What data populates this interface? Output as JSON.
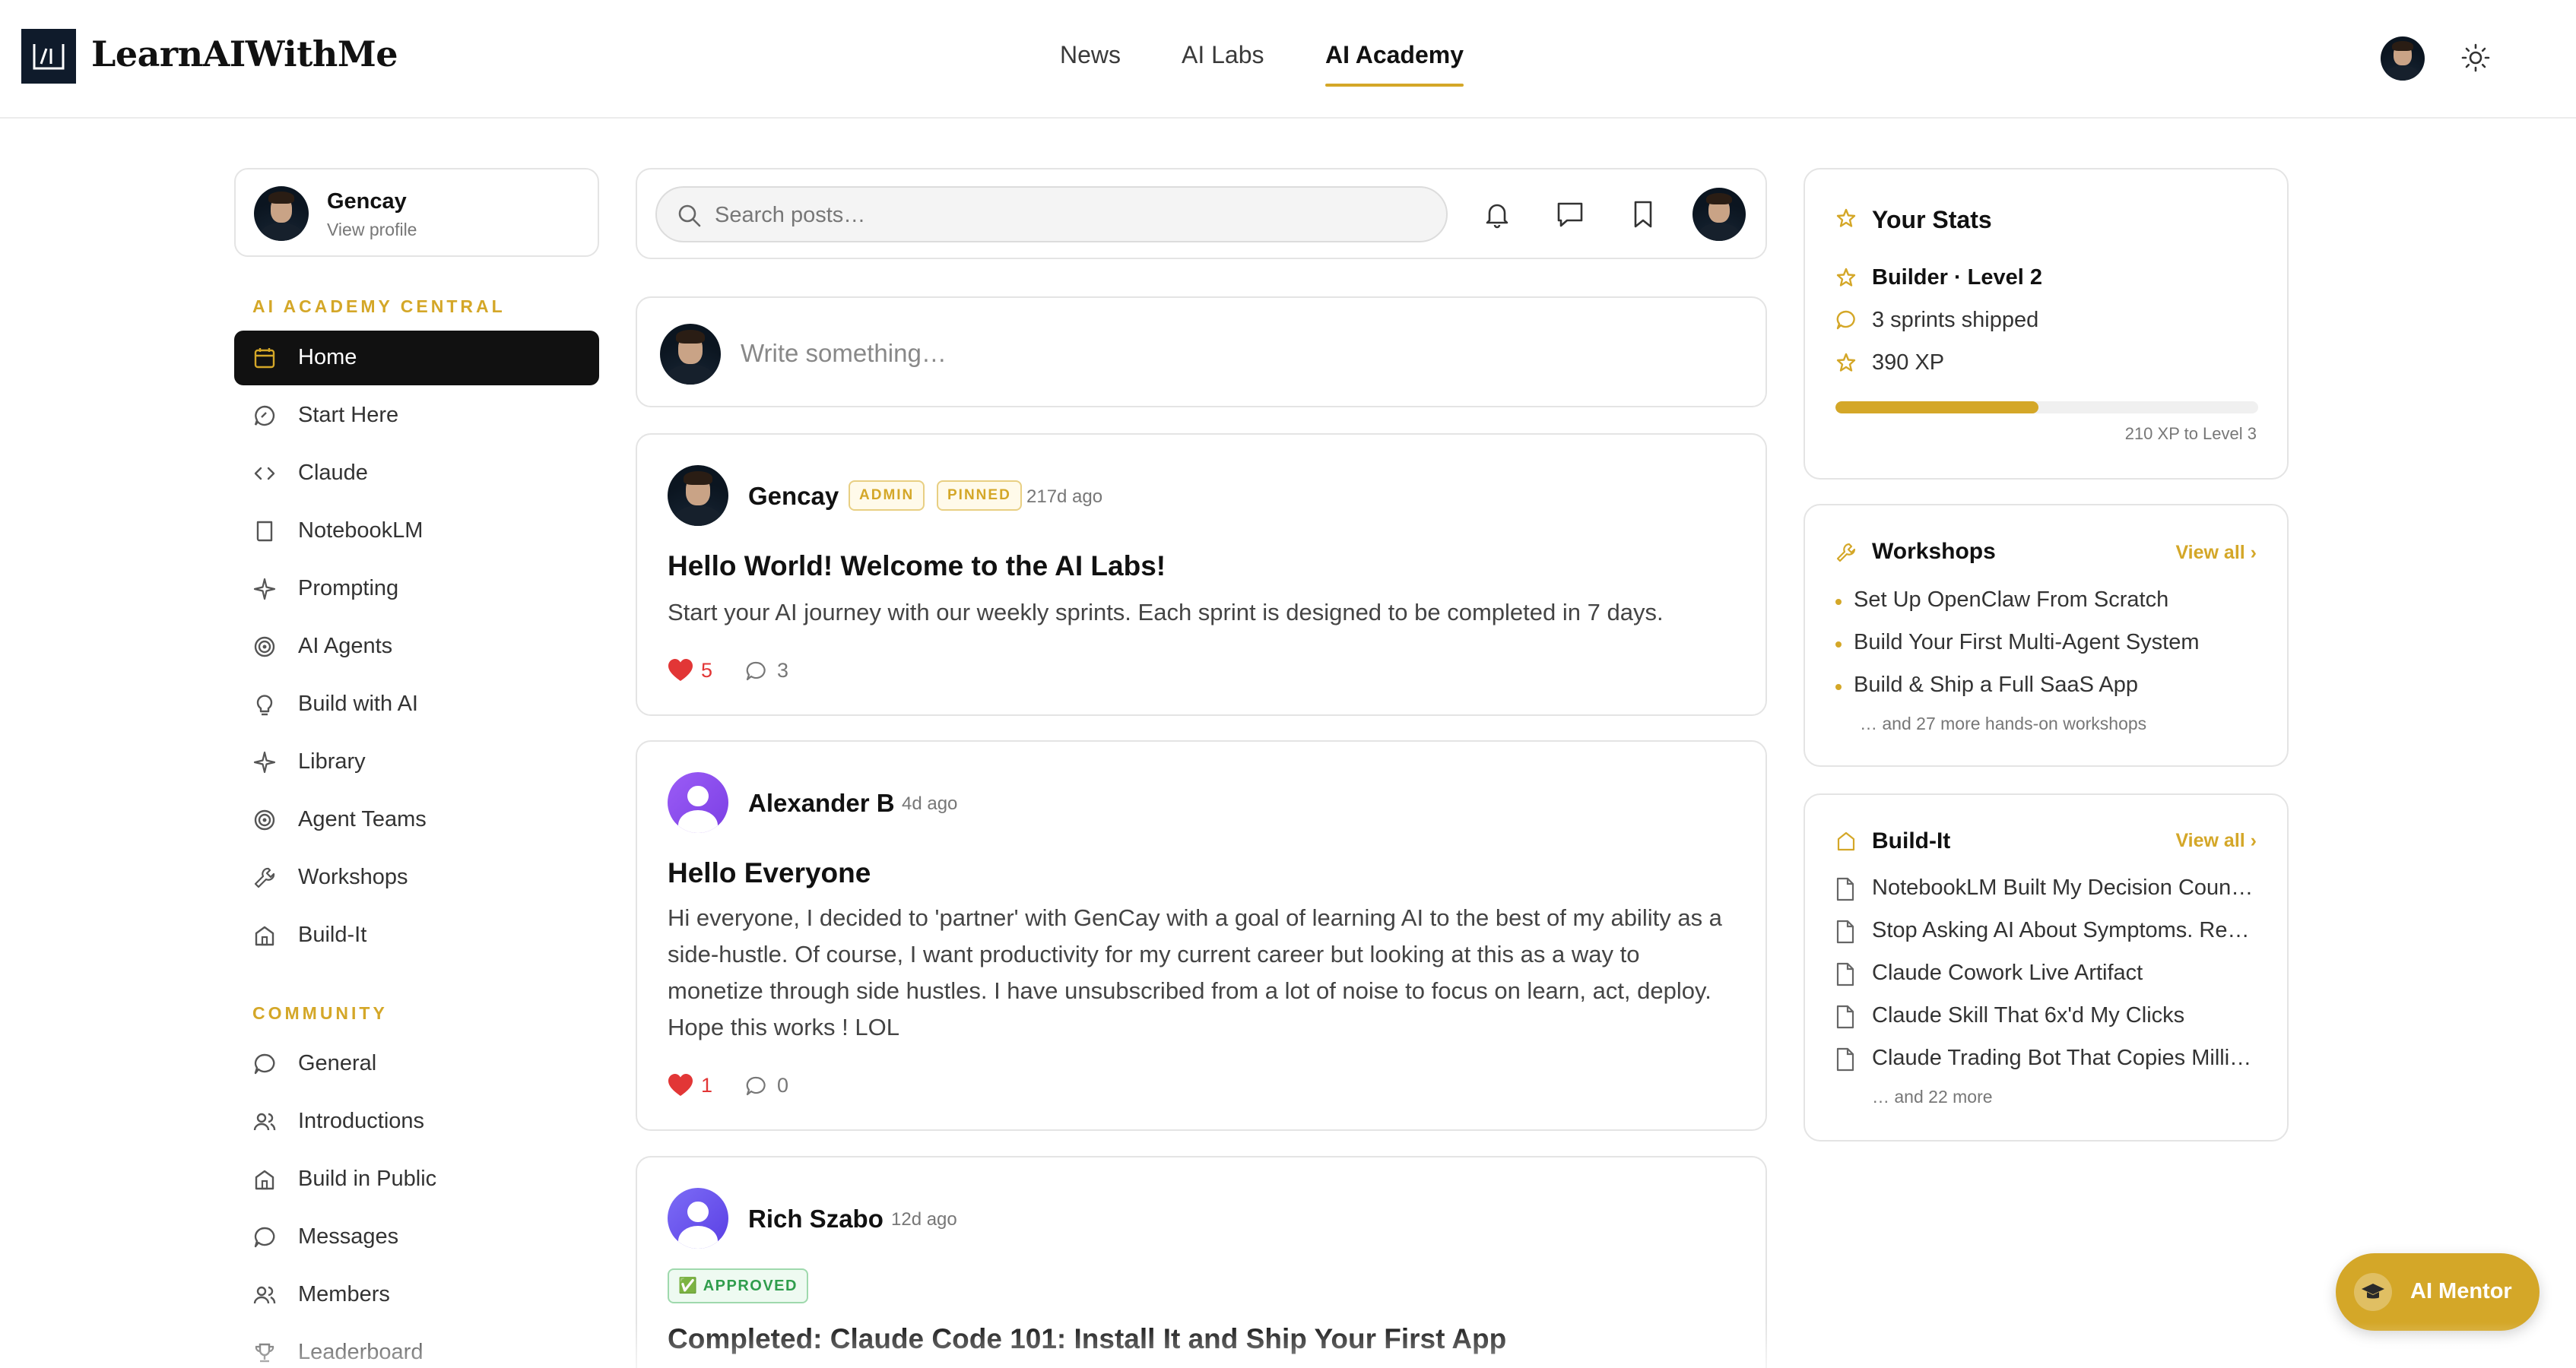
{
  "header": {
    "brand": "LearnAIWithMe",
    "nav": [
      "News",
      "AI Labs",
      "AI Academy"
    ],
    "active_nav": "AI Academy"
  },
  "profile": {
    "name": "Gencay",
    "sub": "View profile"
  },
  "sidebar": {
    "academy_title": "AI ACADEMY CENTRAL",
    "academy_items": [
      {
        "label": "Home",
        "icon": "calendar-icon"
      },
      {
        "label": "Start Here",
        "icon": "rocket-icon"
      },
      {
        "label": "Claude",
        "icon": "code-icon"
      },
      {
        "label": "NotebookLM",
        "icon": "book-icon"
      },
      {
        "label": "Prompting",
        "icon": "sparkle-icon"
      },
      {
        "label": "AI Agents",
        "icon": "target-icon"
      },
      {
        "label": "Build with AI",
        "icon": "lightbulb-icon"
      },
      {
        "label": "Library",
        "icon": "sparkle-icon"
      },
      {
        "label": "Agent Teams",
        "icon": "target-icon"
      },
      {
        "label": "Workshops",
        "icon": "wrench-icon"
      },
      {
        "label": "Build-It",
        "icon": "building-icon"
      }
    ],
    "community_title": "COMMUNITY",
    "community_items": [
      {
        "label": "General",
        "icon": "chat-icon"
      },
      {
        "label": "Introductions",
        "icon": "users-icon"
      },
      {
        "label": "Build in Public",
        "icon": "building-icon"
      },
      {
        "label": "Messages",
        "icon": "chat-icon"
      },
      {
        "label": "Members",
        "icon": "users-icon"
      },
      {
        "label": "Leaderboard",
        "icon": "trophy-icon"
      }
    ]
  },
  "search": {
    "placeholder": "Search posts…"
  },
  "compose": {
    "placeholder": "Write something…"
  },
  "posts": [
    {
      "author": "Gencay",
      "badges": [
        "ADMIN",
        "PINNED"
      ],
      "time": "217d ago",
      "title": "Hello World! Welcome to the AI Labs!",
      "body": "Start your AI journey with our weekly sprints. Each sprint is designed to be completed in 7 days.",
      "likes": "5",
      "comments": "3"
    },
    {
      "author": "Alexander B",
      "time": "4d ago",
      "title": "Hello Everyone",
      "body": "Hi everyone, I decided to 'partner' with GenCay with a goal of learning AI to the best of my ability as a side-hustle. Of course, I want productivity for my current career but looking at this as a way to monetize through side hustles. I have unsubscribed from a lot of noise to focus on learn, act, deploy. Hope this works ! LOL",
      "likes": "1",
      "comments": "0"
    },
    {
      "author": "Rich Szabo",
      "time": "12d ago",
      "badge": "✅ APPROVED",
      "title": "Completed: Claude Code 101: Install It and Ship Your First App"
    }
  ],
  "stats": {
    "title": "Your Stats",
    "level": "Builder · Level 2",
    "sprints": "3 sprints shipped",
    "xp": "390 XP",
    "progress_fraction": 0.48,
    "next_level": "210 XP to Level 3"
  },
  "workshops": {
    "title": "Workshops",
    "view_all": "View all",
    "items": [
      "Set Up OpenClaw From Scratch",
      "Build Your First Multi-Agent System",
      "Build & Ship a Full SaaS App"
    ],
    "more": "… and 27 more hands-on workshops"
  },
  "buildit": {
    "title": "Build-It",
    "view_all": "View all",
    "items": [
      "NotebookLM Built My Decision Council…",
      "Stop Asking AI About Symptoms. Rea…",
      "Claude Cowork Live Artifact",
      "Claude Skill That 6x'd My Clicks",
      "Claude Trading Bot That Copies Millio…"
    ],
    "more": "… and 22 more"
  },
  "mentor": {
    "label": "AI Mentor"
  },
  "colors": {
    "accent": "#d4a728",
    "dark": "#111111",
    "like": "#e23636",
    "approved": "#2f9d4c"
  }
}
